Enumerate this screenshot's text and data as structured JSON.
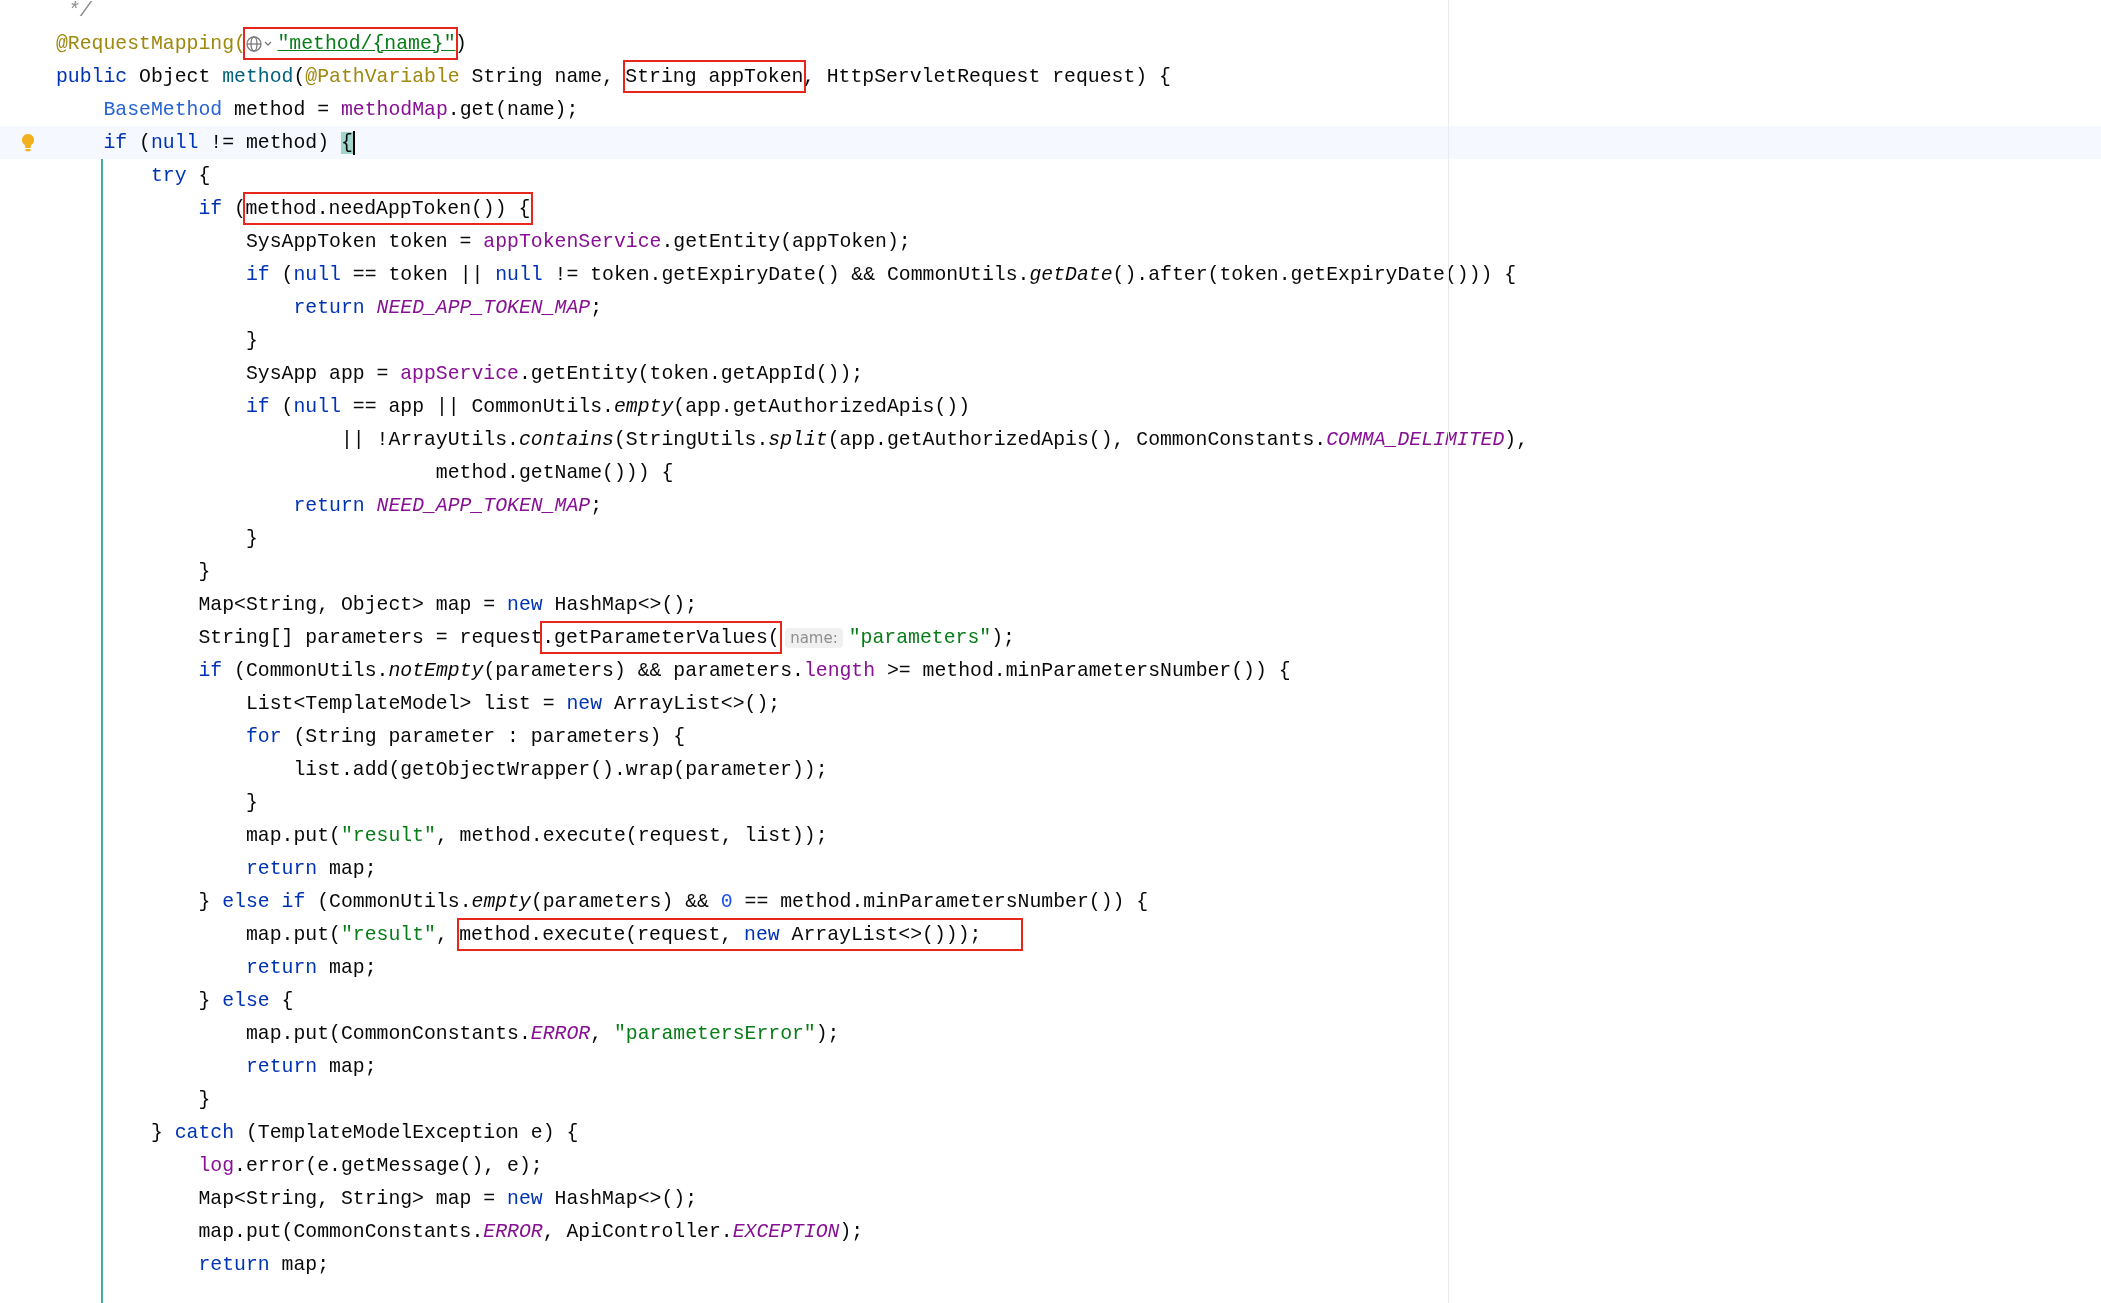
{
  "lines": [
    {
      "current": false,
      "segments": [
        {
          "kind": "code",
          "tokens": [
            {
              "kind": "comment",
              "text": " */"
            }
          ]
        }
      ]
    },
    {
      "current": false,
      "segments": [
        {
          "kind": "code",
          "tokens": [
            {
              "kind": "annotation",
              "text": "@RequestMapping("
            }
          ]
        },
        {
          "kind": "boxed",
          "tokens": [
            {
              "kind": "globe"
            },
            {
              "kind": "link-string",
              "text": "\"method/{name}\""
            }
          ]
        },
        {
          "kind": "code",
          "tokens": [
            {
              "kind": "plain",
              "text": ")"
            }
          ]
        }
      ]
    },
    {
      "current": false,
      "segments": [
        {
          "kind": "code",
          "tokens": [
            {
              "kind": "keyword",
              "text": "public"
            },
            {
              "kind": "plain",
              "text": " Object "
            },
            {
              "kind": "method-decl",
              "text": "method"
            },
            {
              "kind": "plain",
              "text": "("
            },
            {
              "kind": "annotation",
              "text": "@PathVariable"
            },
            {
              "kind": "plain",
              "text": " String name, "
            }
          ]
        },
        {
          "kind": "boxed",
          "tokens": [
            {
              "kind": "plain",
              "text": "String appToken"
            }
          ]
        },
        {
          "kind": "code",
          "tokens": [
            {
              "kind": "plain",
              "text": ", HttpServletRequest request) {"
            }
          ]
        }
      ]
    },
    {
      "current": false,
      "segments": [
        {
          "kind": "code",
          "tokens": [
            {
              "kind": "type",
              "text": "    BaseMethod"
            },
            {
              "kind": "plain",
              "text": " method = "
            },
            {
              "kind": "field",
              "text": "methodMap"
            },
            {
              "kind": "plain",
              "text": ".get(name);"
            }
          ]
        }
      ]
    },
    {
      "current": true,
      "segments": [
        {
          "kind": "code",
          "tokens": [
            {
              "kind": "keyword",
              "text": "    if"
            },
            {
              "kind": "plain",
              "text": " ("
            },
            {
              "kind": "keyword",
              "text": "null"
            },
            {
              "kind": "plain",
              "text": " != method) "
            }
          ]
        },
        {
          "kind": "brace",
          "text": "{"
        },
        {
          "kind": "cursor"
        }
      ]
    },
    {
      "current": false,
      "segments": [
        {
          "kind": "code",
          "tokens": [
            {
              "kind": "keyword",
              "text": "        try"
            },
            {
              "kind": "plain",
              "text": " {"
            }
          ]
        }
      ]
    },
    {
      "current": false,
      "segments": [
        {
          "kind": "code",
          "tokens": [
            {
              "kind": "keyword",
              "text": "            if"
            },
            {
              "kind": "plain",
              "text": " ("
            }
          ]
        },
        {
          "kind": "boxed",
          "tokens": [
            {
              "kind": "plain",
              "text": "method.needAppToken()) {"
            }
          ]
        }
      ]
    },
    {
      "current": false,
      "segments": [
        {
          "kind": "code",
          "tokens": [
            {
              "kind": "plain",
              "text": "                SysAppToken token = "
            },
            {
              "kind": "field",
              "text": "appTokenService"
            },
            {
              "kind": "plain",
              "text": ".getEntity(appToken);"
            }
          ]
        }
      ]
    },
    {
      "current": false,
      "segments": [
        {
          "kind": "code",
          "tokens": [
            {
              "kind": "keyword",
              "text": "                if"
            },
            {
              "kind": "plain",
              "text": " ("
            },
            {
              "kind": "keyword",
              "text": "null"
            },
            {
              "kind": "plain",
              "text": " == token || "
            },
            {
              "kind": "keyword",
              "text": "null"
            },
            {
              "kind": "plain",
              "text": " != token.getExpiryDate() && CommonUtils."
            },
            {
              "kind": "static",
              "text": "getDate"
            },
            {
              "kind": "plain",
              "text": "().after(token.getExpiryDate())) {"
            }
          ]
        }
      ]
    },
    {
      "current": false,
      "segments": [
        {
          "kind": "code",
          "tokens": [
            {
              "kind": "keyword",
              "text": "                    return "
            },
            {
              "kind": "const",
              "text": "NEED_APP_TOKEN_MAP"
            },
            {
              "kind": "plain",
              "text": ";"
            }
          ]
        }
      ]
    },
    {
      "current": false,
      "segments": [
        {
          "kind": "code",
          "tokens": [
            {
              "kind": "plain",
              "text": "                }"
            }
          ]
        }
      ]
    },
    {
      "current": false,
      "segments": [
        {
          "kind": "code",
          "tokens": [
            {
              "kind": "plain",
              "text": "                SysApp app = "
            },
            {
              "kind": "field",
              "text": "appService"
            },
            {
              "kind": "plain",
              "text": ".getEntity(token.getAppId());"
            }
          ]
        }
      ]
    },
    {
      "current": false,
      "segments": [
        {
          "kind": "code",
          "tokens": [
            {
              "kind": "keyword",
              "text": "                if"
            },
            {
              "kind": "plain",
              "text": " ("
            },
            {
              "kind": "keyword",
              "text": "null"
            },
            {
              "kind": "plain",
              "text": " == app || CommonUtils."
            },
            {
              "kind": "static",
              "text": "empty"
            },
            {
              "kind": "plain",
              "text": "(app.getAuthorizedApis())"
            }
          ]
        }
      ]
    },
    {
      "current": false,
      "segments": [
        {
          "kind": "code",
          "tokens": [
            {
              "kind": "plain",
              "text": "                        || !ArrayUtils."
            },
            {
              "kind": "static",
              "text": "contains"
            },
            {
              "kind": "plain",
              "text": "(StringUtils."
            },
            {
              "kind": "static",
              "text": "split"
            },
            {
              "kind": "plain",
              "text": "(app.getAuthorizedApis(), CommonConstants."
            },
            {
              "kind": "const",
              "text": "COMMA_DELIMITED"
            },
            {
              "kind": "plain",
              "text": "),"
            }
          ]
        }
      ]
    },
    {
      "current": false,
      "segments": [
        {
          "kind": "code",
          "tokens": [
            {
              "kind": "plain",
              "text": "                                method.getName())) {"
            }
          ]
        }
      ]
    },
    {
      "current": false,
      "segments": [
        {
          "kind": "code",
          "tokens": [
            {
              "kind": "keyword",
              "text": "                    return "
            },
            {
              "kind": "const",
              "text": "NEED_APP_TOKEN_MAP"
            },
            {
              "kind": "plain",
              "text": ";"
            }
          ]
        }
      ]
    },
    {
      "current": false,
      "segments": [
        {
          "kind": "code",
          "tokens": [
            {
              "kind": "plain",
              "text": "                }"
            }
          ]
        }
      ]
    },
    {
      "current": false,
      "segments": [
        {
          "kind": "code",
          "tokens": [
            {
              "kind": "plain",
              "text": "            }"
            }
          ]
        }
      ]
    },
    {
      "current": false,
      "segments": [
        {
          "kind": "code",
          "tokens": [
            {
              "kind": "plain",
              "text": "            Map<String, Object> map = "
            },
            {
              "kind": "keyword",
              "text": "new"
            },
            {
              "kind": "plain",
              "text": " HashMap<>();"
            }
          ]
        }
      ]
    },
    {
      "current": false,
      "segments": [
        {
          "kind": "code",
          "tokens": [
            {
              "kind": "plain",
              "text": "            String[] parameters = request"
            }
          ]
        },
        {
          "kind": "boxed",
          "tokens": [
            {
              "kind": "plain",
              "text": ".getParameterValues("
            }
          ]
        },
        {
          "kind": "hint",
          "text": "name:"
        },
        {
          "kind": "code",
          "tokens": [
            {
              "kind": "string",
              "text": "\"parameters\""
            },
            {
              "kind": "plain",
              "text": ");"
            }
          ]
        }
      ]
    },
    {
      "current": false,
      "segments": [
        {
          "kind": "code",
          "tokens": [
            {
              "kind": "keyword",
              "text": "            if"
            },
            {
              "kind": "plain",
              "text": " (CommonUtils."
            },
            {
              "kind": "static",
              "text": "notEmpty"
            },
            {
              "kind": "plain",
              "text": "(parameters) && parameters."
            },
            {
              "kind": "field",
              "text": "length"
            },
            {
              "kind": "plain",
              "text": " >= method.minParametersNumber()) {"
            }
          ]
        }
      ]
    },
    {
      "current": false,
      "segments": [
        {
          "kind": "code",
          "tokens": [
            {
              "kind": "plain",
              "text": "                List<TemplateModel> list = "
            },
            {
              "kind": "keyword",
              "text": "new"
            },
            {
              "kind": "plain",
              "text": " ArrayList<>();"
            }
          ]
        }
      ]
    },
    {
      "current": false,
      "segments": [
        {
          "kind": "code",
          "tokens": [
            {
              "kind": "keyword",
              "text": "                for"
            },
            {
              "kind": "plain",
              "text": " (String parameter : parameters) {"
            }
          ]
        }
      ]
    },
    {
      "current": false,
      "segments": [
        {
          "kind": "code",
          "tokens": [
            {
              "kind": "plain",
              "text": "                    list.add(getObjectWrapper().wrap(parameter));"
            }
          ]
        }
      ]
    },
    {
      "current": false,
      "segments": [
        {
          "kind": "code",
          "tokens": [
            {
              "kind": "plain",
              "text": "                }"
            }
          ]
        }
      ]
    },
    {
      "current": false,
      "segments": [
        {
          "kind": "code",
          "tokens": [
            {
              "kind": "plain",
              "text": "                map.put("
            },
            {
              "kind": "string",
              "text": "\"result\""
            },
            {
              "kind": "plain",
              "text": ", method.execute(request, list));"
            }
          ]
        }
      ]
    },
    {
      "current": false,
      "segments": [
        {
          "kind": "code",
          "tokens": [
            {
              "kind": "keyword",
              "text": "                return"
            },
            {
              "kind": "plain",
              "text": " map;"
            }
          ]
        }
      ]
    },
    {
      "current": false,
      "segments": [
        {
          "kind": "code",
          "tokens": [
            {
              "kind": "plain",
              "text": "            } "
            },
            {
              "kind": "keyword",
              "text": "else if"
            },
            {
              "kind": "plain",
              "text": " (CommonUtils."
            },
            {
              "kind": "static",
              "text": "empty"
            },
            {
              "kind": "plain",
              "text": "(parameters) && "
            },
            {
              "kind": "number",
              "text": "0"
            },
            {
              "kind": "plain",
              "text": " == method.minParametersNumber()) {"
            }
          ]
        }
      ]
    },
    {
      "current": false,
      "segments": [
        {
          "kind": "code",
          "tokens": [
            {
              "kind": "plain",
              "text": "                map.put("
            },
            {
              "kind": "string",
              "text": "\"result\""
            },
            {
              "kind": "plain",
              "text": ", "
            }
          ]
        },
        {
          "kind": "boxed",
          "wide": true,
          "tokens": [
            {
              "kind": "plain",
              "text": "method.execute(request, "
            },
            {
              "kind": "keyword",
              "text": "new"
            },
            {
              "kind": "plain",
              "text": " ArrayList<>()));"
            }
          ]
        }
      ]
    },
    {
      "current": false,
      "segments": [
        {
          "kind": "code",
          "tokens": [
            {
              "kind": "keyword",
              "text": "                return"
            },
            {
              "kind": "plain",
              "text": " map;"
            }
          ]
        }
      ]
    },
    {
      "current": false,
      "segments": [
        {
          "kind": "code",
          "tokens": [
            {
              "kind": "plain",
              "text": "            } "
            },
            {
              "kind": "keyword",
              "text": "else"
            },
            {
              "kind": "plain",
              "text": " {"
            }
          ]
        }
      ]
    },
    {
      "current": false,
      "segments": [
        {
          "kind": "code",
          "tokens": [
            {
              "kind": "plain",
              "text": "                map.put(CommonConstants."
            },
            {
              "kind": "const",
              "text": "ERROR"
            },
            {
              "kind": "plain",
              "text": ", "
            },
            {
              "kind": "string",
              "text": "\"parametersError\""
            },
            {
              "kind": "plain",
              "text": ");"
            }
          ]
        }
      ]
    },
    {
      "current": false,
      "segments": [
        {
          "kind": "code",
          "tokens": [
            {
              "kind": "keyword",
              "text": "                return"
            },
            {
              "kind": "plain",
              "text": " map;"
            }
          ]
        }
      ]
    },
    {
      "current": false,
      "segments": [
        {
          "kind": "code",
          "tokens": [
            {
              "kind": "plain",
              "text": "            }"
            }
          ]
        }
      ]
    },
    {
      "current": false,
      "segments": [
        {
          "kind": "code",
          "tokens": [
            {
              "kind": "plain",
              "text": "        } "
            },
            {
              "kind": "keyword",
              "text": "catch"
            },
            {
              "kind": "plain",
              "text": " (TemplateModelException e) {"
            }
          ]
        }
      ]
    },
    {
      "current": false,
      "segments": [
        {
          "kind": "code",
          "tokens": [
            {
              "kind": "field",
              "text": "            log"
            },
            {
              "kind": "plain",
              "text": ".error(e.getMessage(), e);"
            }
          ]
        }
      ]
    },
    {
      "current": false,
      "segments": [
        {
          "kind": "code",
          "tokens": [
            {
              "kind": "plain",
              "text": "            Map<String, String> map = "
            },
            {
              "kind": "keyword",
              "text": "new"
            },
            {
              "kind": "plain",
              "text": " HashMap<>();"
            }
          ]
        }
      ]
    },
    {
      "current": false,
      "segments": [
        {
          "kind": "code",
          "tokens": [
            {
              "kind": "plain",
              "text": "            map.put(CommonConstants."
            },
            {
              "kind": "const",
              "text": "ERROR"
            },
            {
              "kind": "plain",
              "text": ", ApiController."
            },
            {
              "kind": "const",
              "text": "EXCEPTION"
            },
            {
              "kind": "plain",
              "text": ");"
            }
          ]
        }
      ]
    },
    {
      "current": false,
      "segments": [
        {
          "kind": "code",
          "tokens": [
            {
              "kind": "keyword",
              "text": "            return"
            },
            {
              "kind": "plain",
              "text": " map;"
            }
          ]
        }
      ]
    }
  ]
}
